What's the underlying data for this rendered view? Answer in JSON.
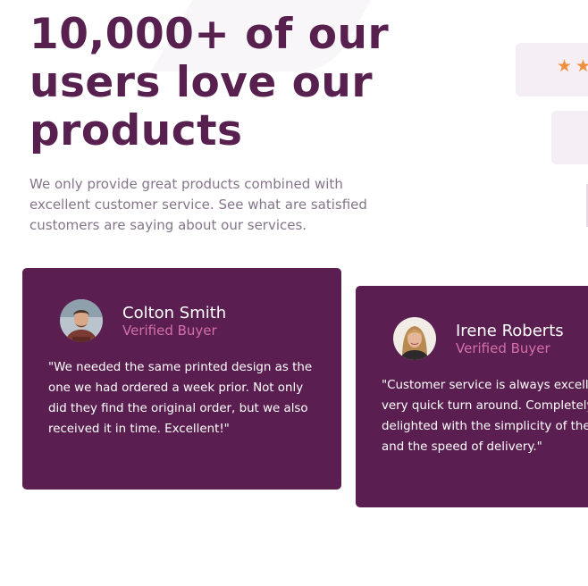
{
  "hero": {
    "headline_lines": [
      "10,000+ of our",
      "users love our",
      "products"
    ],
    "intro_lines": [
      "We only provide great products combined with",
      "excellent customer service. See what are satisfied",
      "customers are saying about our services."
    ]
  },
  "rating": {
    "stars_visible": 2,
    "star_color": "#ef8f3c",
    "icon": "star-icon"
  },
  "colors": {
    "brand": "#57204f",
    "card_bg": "#5a1f50",
    "accent": "#d36fa8",
    "muted_text": "#857589"
  },
  "testimonials": [
    {
      "name": "Colton Smith",
      "badge": "Verified Buyer",
      "avatar_icon": "avatar-colton",
      "quote_lines": [
        "\"We needed the same printed design as the",
        "one we had ordered a week prior. Not only",
        "did they find the original order, but we also",
        "received it in time. Excellent!\""
      ]
    },
    {
      "name": "Irene Roberts",
      "badge": "Verified Buyer",
      "avatar_icon": "avatar-irene",
      "quote_lines": [
        "\"Customer service is always excelle",
        "very quick turn around. Completely",
        "delighted with the simplicity of the",
        "and the speed of delivery.\""
      ]
    }
  ]
}
